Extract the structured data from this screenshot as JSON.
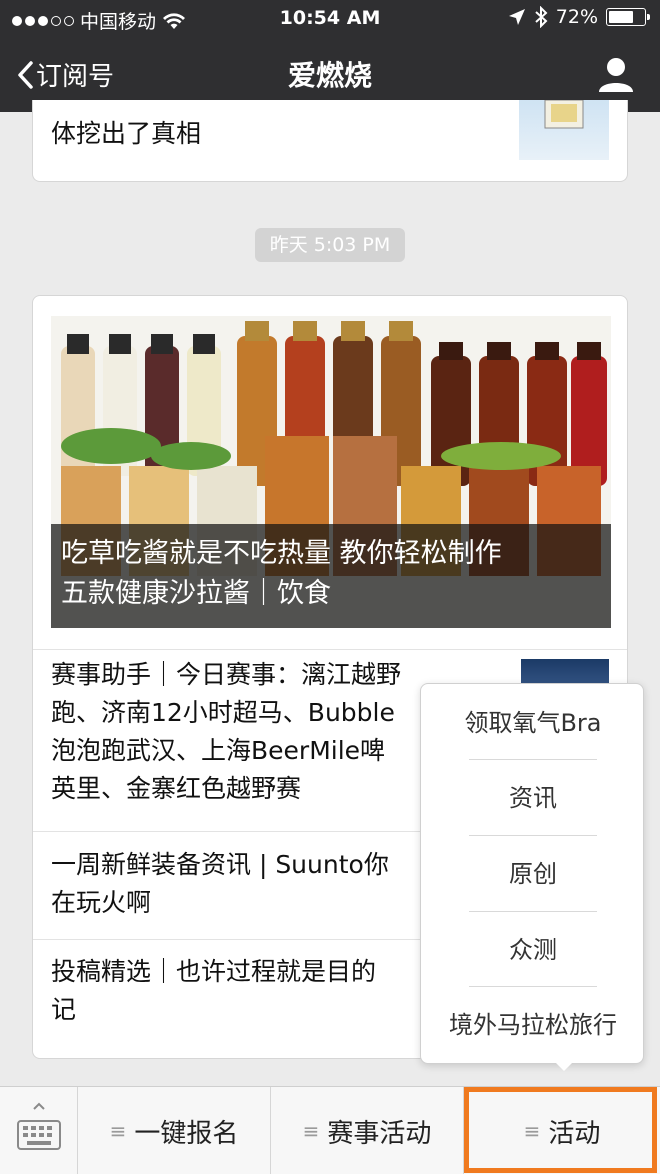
{
  "status_bar": {
    "carrier": "中国移动",
    "time": "10:54 AM",
    "battery": "72%",
    "battery_level": 0.72
  },
  "nav": {
    "back_label": "订阅号",
    "title": "爱燃烧"
  },
  "feed": {
    "top_card_title": "体挖出了真相",
    "timestamp": "昨天 5:03 PM",
    "hero_caption_line1": "吃草吃酱就是不吃热量 教你轻松制作",
    "hero_caption_line2": "五款健康沙拉酱｜饮食",
    "articles": [
      {
        "lines": [
          "赛事助手｜今日赛事：漓江越野",
          "跑、济南12小时超马、Bubble",
          "泡泡跑武汉、上海BeerMile啤",
          "英里、金寨红色越野赛"
        ]
      },
      {
        "lines": [
          "一周新鲜装备资讯 | Suunto你",
          "在玩火啊"
        ]
      },
      {
        "lines": [
          "投稿精选｜也许过程就是目的",
          "记"
        ]
      }
    ]
  },
  "popup_menu": {
    "items": [
      "领取氧气Bra",
      "资讯",
      "原创",
      "众测",
      "境外马拉松旅行"
    ]
  },
  "menubar": {
    "tabs": [
      "一键报名",
      "赛事活动",
      "活动"
    ]
  },
  "colors": {
    "nav_bg": "#2f2f31",
    "highlight": "#f07a1f"
  }
}
